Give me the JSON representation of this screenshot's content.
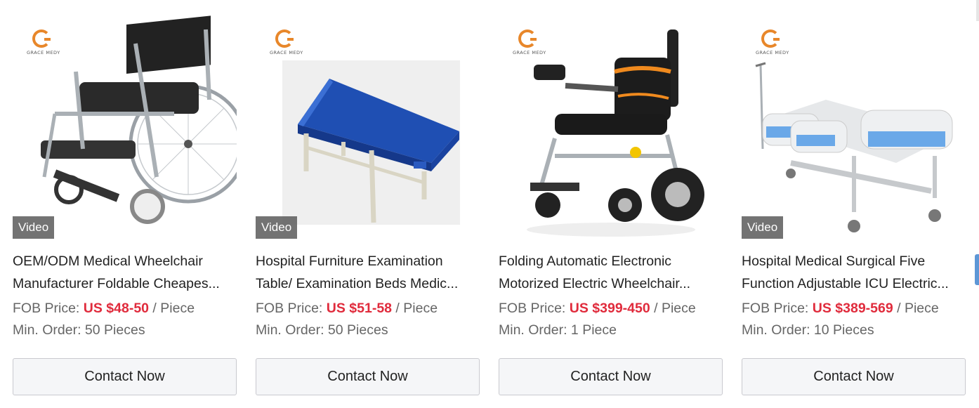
{
  "brand": "GRACE MEDY",
  "colors": {
    "price": "#e02b3c",
    "logo": "#e8872a",
    "button_bg": "#f5f6f8",
    "side_tab": "#5d97d6"
  },
  "products": [
    {
      "title_line1": "OEM/ODM Medical Wheelchair",
      "title_line2": "Manufacturer Foldable Cheapes...",
      "price_label": "FOB Price: ",
      "price_value": "US $48-50",
      "price_unit": " / Piece",
      "moq": "Min. Order: 50 Pieces",
      "video": "Video",
      "button": "Contact Now",
      "image": "manual-wheelchair"
    },
    {
      "title_line1": "Hospital Furniture Examination",
      "title_line2": "Table/ Examination Beds Medic...",
      "price_label": "FOB Price: ",
      "price_value": "US $51-58",
      "price_unit": " / Piece",
      "moq": "Min. Order: 50 Pieces",
      "video": "Video",
      "button": "Contact Now",
      "image": "examination-table"
    },
    {
      "title_line1": "Folding Automatic Electronic",
      "title_line2": "Motorized Electric Wheelchair...",
      "price_label": "FOB Price: ",
      "price_value": "US $399-450",
      "price_unit": " / Piece",
      "moq": "Min. Order: 1 Piece",
      "video": "",
      "button": "Contact Now",
      "image": "electric-wheelchair"
    },
    {
      "title_line1": "Hospital Medical Surgical Five",
      "title_line2": "Function Adjustable ICU Electric...",
      "price_label": "FOB Price: ",
      "price_value": "US $389-569",
      "price_unit": " / Piece",
      "moq": "Min. Order: 10 Pieces",
      "video": "Video",
      "button": "Contact Now",
      "image": "icu-bed"
    }
  ]
}
